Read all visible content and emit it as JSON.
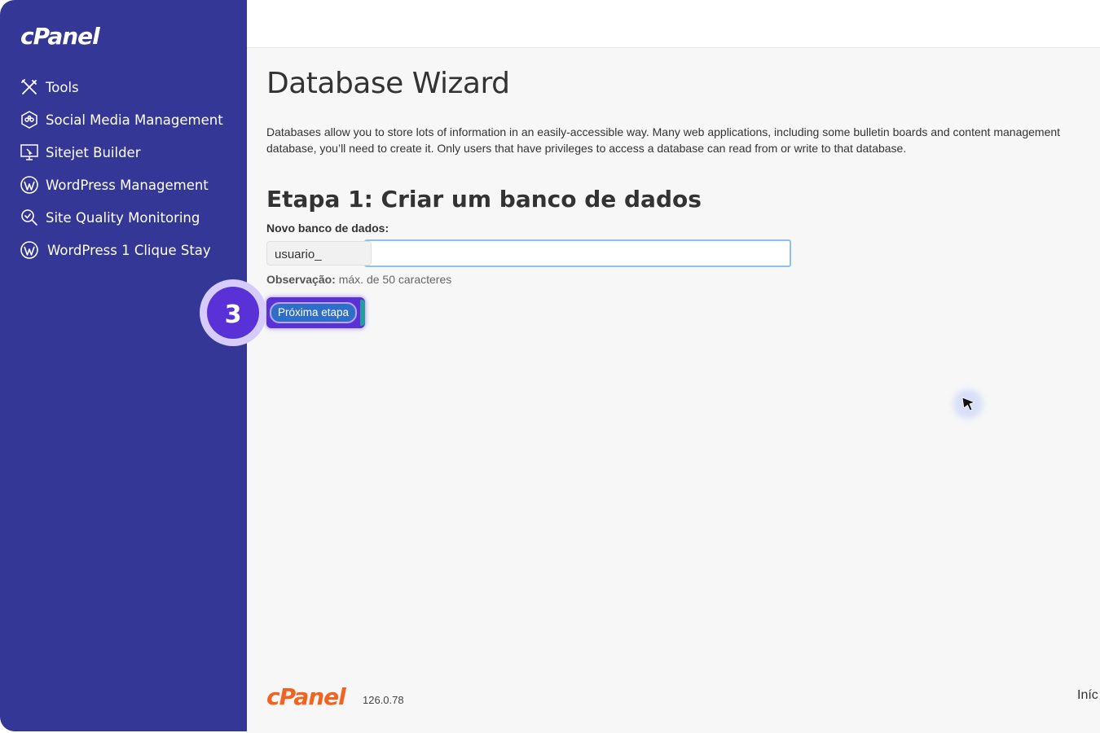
{
  "sidebar": {
    "logo": "cPanel",
    "items": [
      {
        "label": "Tools",
        "icon": "tools-icon"
      },
      {
        "label": "Social Media Management",
        "icon": "social-media-icon"
      },
      {
        "label": "Sitejet Builder",
        "icon": "monitor-icon"
      },
      {
        "label": "WordPress Management",
        "icon": "wordpress-icon"
      },
      {
        "label": "Site Quality Monitoring",
        "icon": "magnifier-check-icon"
      },
      {
        "label": "WordPress 1 Clique Stay",
        "icon": "wordpress-icon"
      }
    ]
  },
  "main": {
    "title": "Database Wizard",
    "description_line1": "Databases allow you to store lots of information in an easily-accessible way. Many web applications, including some bulletin boards and content management",
    "description_line2": "database, you’ll need to create it. Only users that have privileges to access a database can read from or write to that database.",
    "step_title": "Etapa 1: Criar um banco de dados",
    "field_label": "Novo banco de dados:",
    "prefix": "usuario_",
    "input_value": "",
    "note_label": "Observação:",
    "note_text": " máx. de 50 caracteres",
    "next_button": "Próxima etapa"
  },
  "overlay": {
    "step_number": "3",
    "badge_color": "#5a31d6"
  },
  "footer": {
    "logo": "cPanel",
    "version": "126.0.78",
    "link": "Iníc"
  },
  "colors": {
    "sidebar_bg": "#343795",
    "brand_orange": "#f26322",
    "button_blue": "#2f6ec8"
  }
}
